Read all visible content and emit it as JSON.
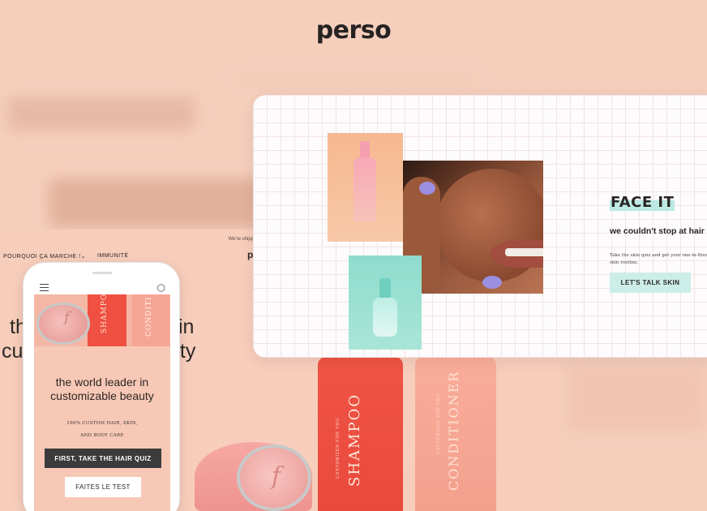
{
  "brand": {
    "logo_text": "perso"
  },
  "desktop_page": {
    "announcement": "We're shipping vitamins in bottles to speed up d",
    "nav": [
      {
        "label": "POURQUOI ÇA MARCHE !"
      },
      {
        "label": "IMMUNITÉ"
      }
    ],
    "nav_chevron": "chevron-down-icon",
    "logo_fragment": "p",
    "hero_title_fragments": [
      "th",
      "in",
      "cu",
      "uty"
    ]
  },
  "products": {
    "shampoo_label": "SHAMPOO",
    "shampoo_small": "CUSTOMIZED FOR YOU",
    "conditioner_label": "CONDITIONER",
    "conditioner_small": "CUSTOMIZED FOR YOU",
    "jar_mark": "f"
  },
  "phone": {
    "menu_icon": "hamburger-menu-icon",
    "cart_icon": "box-icon",
    "hero_shampoo": "SHAMPOO",
    "hero_conditioner": "CONDITI",
    "hero_jar_mark": "f",
    "title": "the world leader in customizable beauty",
    "subtitle_line1": "100% CUSTOM HAIR, SKIN,",
    "subtitle_line2": "AND BODY CARE",
    "primary_button": "FIRST, TAKE THE HAIR QUIZ",
    "secondary_button": "FAITES LE TEST"
  },
  "face_card": {
    "heading": "FACE IT",
    "subheading": "we couldn't stop at hair",
    "body": "Take the skin quiz and get your one-in-three skin routine.",
    "button": "LET'S TALK SKIN"
  },
  "colors": {
    "background": "#f5cfbc",
    "shampoo": "#ef5041",
    "conditioner": "#f6a595",
    "mint_accent": "#bde9e3",
    "dark_button": "#3b3b3b"
  }
}
